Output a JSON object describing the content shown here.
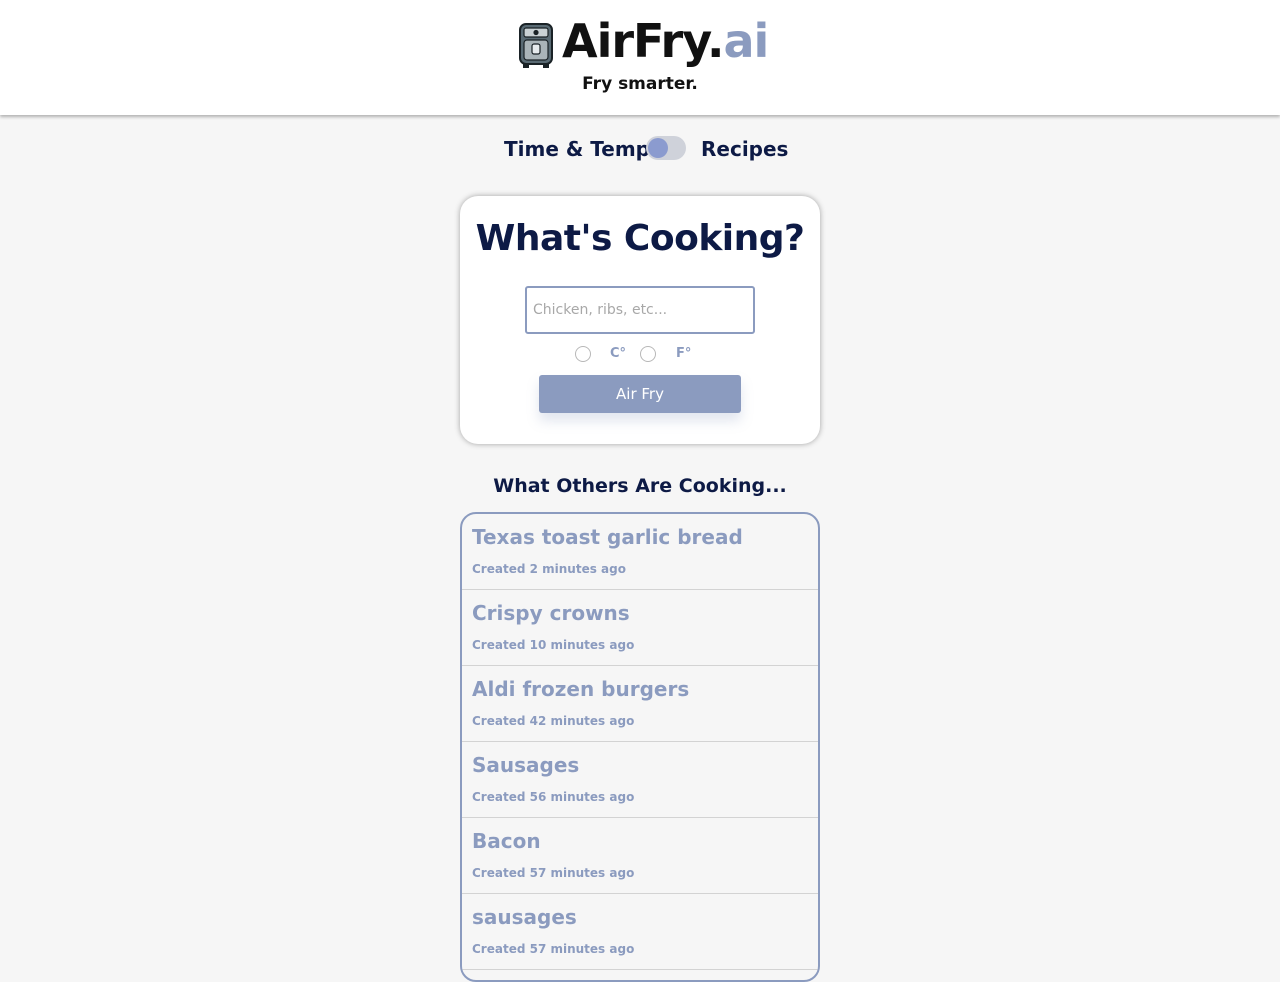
{
  "header": {
    "brand_main": "AirFry.",
    "brand_suffix": "ai",
    "tagline": "Fry smarter.",
    "logo_icon": "air-fryer-icon"
  },
  "mode_toggle": {
    "left_label": "Time & Temp",
    "right_label": "Recipes",
    "checked": false
  },
  "search_card": {
    "title": "What's Cooking?",
    "input_value": "",
    "input_placeholder": "Chicken, ribs, etc...",
    "units": [
      {
        "label": "C°",
        "selected": false
      },
      {
        "label": "F°",
        "selected": false
      }
    ],
    "submit_label": "Air Fry"
  },
  "recent": {
    "title": "What Others Are Cooking...",
    "items": [
      {
        "name": "Texas toast garlic bread",
        "created": "Created 2 minutes ago"
      },
      {
        "name": "Crispy crowns",
        "created": "Created 10 minutes ago"
      },
      {
        "name": "Aldi frozen burgers",
        "created": "Created 42 minutes ago"
      },
      {
        "name": "Sausages",
        "created": "Created 56 minutes ago"
      },
      {
        "name": "Bacon",
        "created": "Created 57 minutes ago"
      },
      {
        "name": "sausages",
        "created": "Created 57 minutes ago"
      }
    ]
  },
  "colors": {
    "accent": "#8b9bbf",
    "navy": "#0d1a45",
    "background": "#f6f6f6"
  }
}
